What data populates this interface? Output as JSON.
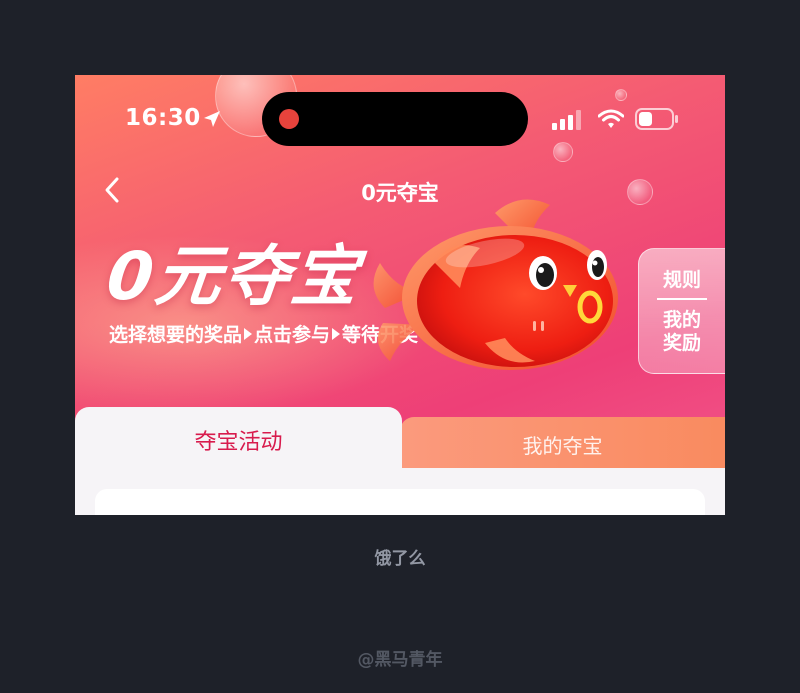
{
  "status_bar": {
    "time": "16:30"
  },
  "nav": {
    "title": "0元夺宝"
  },
  "hero": {
    "title": "0元夺宝",
    "steps": [
      "选择想要的奖品",
      "点击参与",
      "等待开奖"
    ]
  },
  "side_panel": {
    "rules": "规则",
    "my_reward_line1": "我的",
    "my_reward_line2": "奖励"
  },
  "tabs": [
    {
      "label": "夺宝活动",
      "active": true
    },
    {
      "label": "我的夺宝",
      "active": false
    }
  ],
  "caption": "饿了么",
  "watermark": "@黑马青年",
  "colors": {
    "accent": "#d81b4d",
    "banner": "#f45b73",
    "tab_inactive": "#f98a5e",
    "background": "#1e2129"
  }
}
